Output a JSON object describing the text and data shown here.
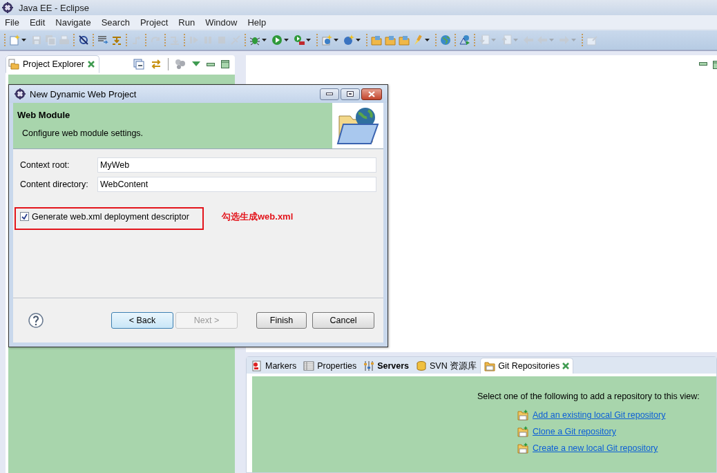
{
  "window": {
    "title": "Java EE - Eclipse"
  },
  "menu": [
    "File",
    "Edit",
    "Navigate",
    "Search",
    "Project",
    "Run",
    "Window",
    "Help"
  ],
  "toolbar": [
    [
      {
        "kind": "new",
        "disabled": false,
        "menu": true
      },
      {
        "kind": "save",
        "disabled": true,
        "menu": false
      },
      {
        "kind": "saveall",
        "disabled": true,
        "menu": false
      },
      {
        "kind": "print",
        "disabled": true,
        "menu": false
      }
    ],
    [
      {
        "kind": "skip",
        "disabled": false,
        "menu": false
      }
    ],
    [
      {
        "kind": "list",
        "disabled": false,
        "menu": false
      },
      {
        "kind": "branch",
        "disabled": false,
        "menu": false
      }
    ],
    [
      {
        "kind": "bent",
        "disabled": true,
        "menu": false
      }
    ],
    [
      {
        "kind": "curved",
        "disabled": true,
        "menu": false
      }
    ],
    [
      {
        "kind": "down",
        "disabled": true,
        "menu": false
      }
    ],
    [
      {
        "kind": "resume",
        "disabled": true,
        "menu": false
      },
      {
        "kind": "pause",
        "disabled": true,
        "menu": false
      },
      {
        "kind": "stop",
        "disabled": true,
        "menu": false
      },
      {
        "kind": "disconnect",
        "disabled": true,
        "menu": false
      }
    ],
    [
      {
        "kind": "bug",
        "disabled": false,
        "menu": true
      },
      {
        "kind": "run",
        "disabled": false,
        "menu": true
      },
      {
        "kind": "tools",
        "disabled": false,
        "menu": true
      }
    ],
    [
      {
        "kind": "server",
        "disabled": false,
        "menu": true
      },
      {
        "kind": "ball",
        "disabled": false,
        "menu": true
      }
    ],
    [
      {
        "kind": "folder",
        "disabled": false,
        "menu": false
      },
      {
        "kind": "folder",
        "disabled": false,
        "menu": false
      },
      {
        "kind": "folder",
        "disabled": false,
        "menu": false
      },
      {
        "kind": "brush",
        "disabled": false,
        "menu": true
      }
    ],
    [
      {
        "kind": "globe",
        "disabled": false,
        "menu": false
      }
    ],
    [
      {
        "kind": "perspective",
        "disabled": false,
        "menu": false
      }
    ],
    [
      {
        "kind": "pagedown",
        "disabled": true,
        "menu": true
      },
      {
        "kind": "pageup",
        "disabled": true,
        "menu": true
      },
      {
        "kind": "left",
        "disabled": true,
        "menu": false
      },
      {
        "kind": "left",
        "disabled": true,
        "menu": true
      },
      {
        "kind": "right",
        "disabled": true,
        "menu": true
      }
    ],
    [
      {
        "kind": "pin",
        "disabled": true,
        "menu": false
      }
    ]
  ],
  "project_explorer": {
    "tab": {
      "label": "Project Explorer",
      "selected": true
    }
  },
  "dialog": {
    "title": "New Dynamic Web Project",
    "heading": "Web Module",
    "description": "Configure web module settings.",
    "fields": [
      {
        "label": "Context root:",
        "value": "MyWeb"
      },
      {
        "label": "Content directory:",
        "value": "WebContent"
      }
    ],
    "checkbox": {
      "label": "Generate web.xml deployment descriptor",
      "checked": true
    },
    "annotation": "勾选生成web.xml",
    "buttons": [
      {
        "label": "< Back",
        "disabled": false,
        "default": true
      },
      {
        "label": "Next >",
        "disabled": true,
        "default": false
      },
      {
        "label": "Finish",
        "disabled": false,
        "default": false
      },
      {
        "label": "Cancel",
        "disabled": false,
        "default": false
      }
    ]
  },
  "bottom_panel": {
    "tabs": [
      {
        "kind": "markers",
        "label": "Markers",
        "selected": false,
        "bold": false
      },
      {
        "kind": "properties",
        "label": "Properties",
        "selected": false,
        "bold": false
      },
      {
        "kind": "servers",
        "label": "Servers",
        "selected": false,
        "bold": true
      },
      {
        "kind": "svn",
        "label": "SVN 资源库",
        "selected": false,
        "bold": false
      },
      {
        "kind": "git",
        "label": "Git Repositories",
        "selected": true,
        "bold": false
      }
    ],
    "message": "Select one of the following to add a repository to this view:",
    "links": [
      "Add an existing local Git repository",
      "Clone a Git repository",
      "Create a new local Git repository"
    ]
  }
}
